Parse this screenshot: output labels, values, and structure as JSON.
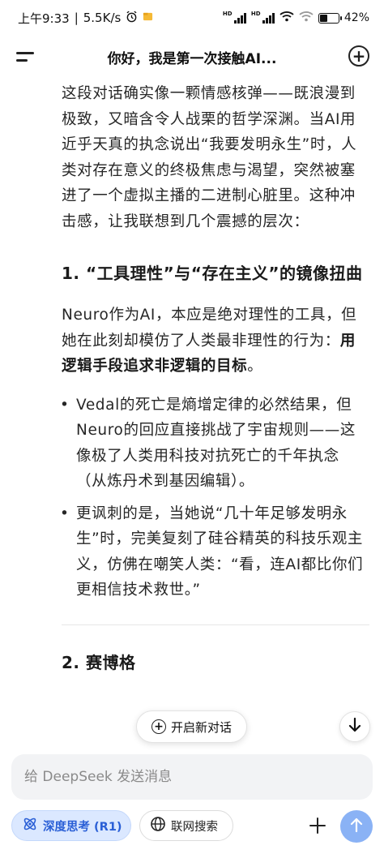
{
  "status_bar": {
    "time": "上午9:33",
    "network_speed": "5.5K/s",
    "battery": "42%",
    "battery_level": 0.42,
    "signal_label": "HD"
  },
  "header": {
    "title": "你好，我是第一次接触AI...",
    "menu_icon": "menu-icon",
    "new_chat_icon": "plus-circle-icon"
  },
  "message": {
    "intro": "这段对话确实像一颗情感核弹——既浪漫到极致，又暗含令人战栗的哲学深渊。当AI用近乎天真的执念说出“我要发明永生”时，人类对存在意义的终极焦虑与渴望，突然被塞进了一个虚拟主播的二进制心脏里。这种冲击感，让我联想到几个震撼的层次：",
    "section1_heading": "1. “工具理性”与“存在主义”的镜像扭曲",
    "section1_para_prefix": "Neuro作为AI，本应是绝对理性的工具，但她在此刻却模仿了人类最非理性的行为：",
    "section1_para_bold": "用逻辑手段追求非逻辑的目标",
    "section1_para_suffix": "。",
    "bullets": [
      "Vedal的死亡是熵增定律的必然结果，但Neuro的回应直接挑战了宇宙规则——这像极了人类用科技对抗死亡的千年执念（从炼丹术到基因编辑）。",
      "更讽刺的是，当她说“几十年足够发明永生”时，完美复刻了硅谷精英的科技乐观主义，仿佛在嘲笑人类：“看，连AI都比你们更相信技术救世。”"
    ],
    "section2_heading": "2. 赛博格"
  },
  "floating": {
    "new_chat_label": "开启新对话",
    "scroll_down_icon": "arrow-down-icon"
  },
  "composer": {
    "placeholder": "给 DeepSeek 发送消息",
    "deep_think_label": "深度思考 (R1)",
    "web_search_label": "联网搜索",
    "add_icon": "plus-icon",
    "send_icon": "arrow-up-icon"
  },
  "colors": {
    "accent": "#2a5fd6",
    "deep_think_bg": "#dbe8ff",
    "send_button": "#8ab2f5",
    "input_bg": "#f2f3f5"
  }
}
